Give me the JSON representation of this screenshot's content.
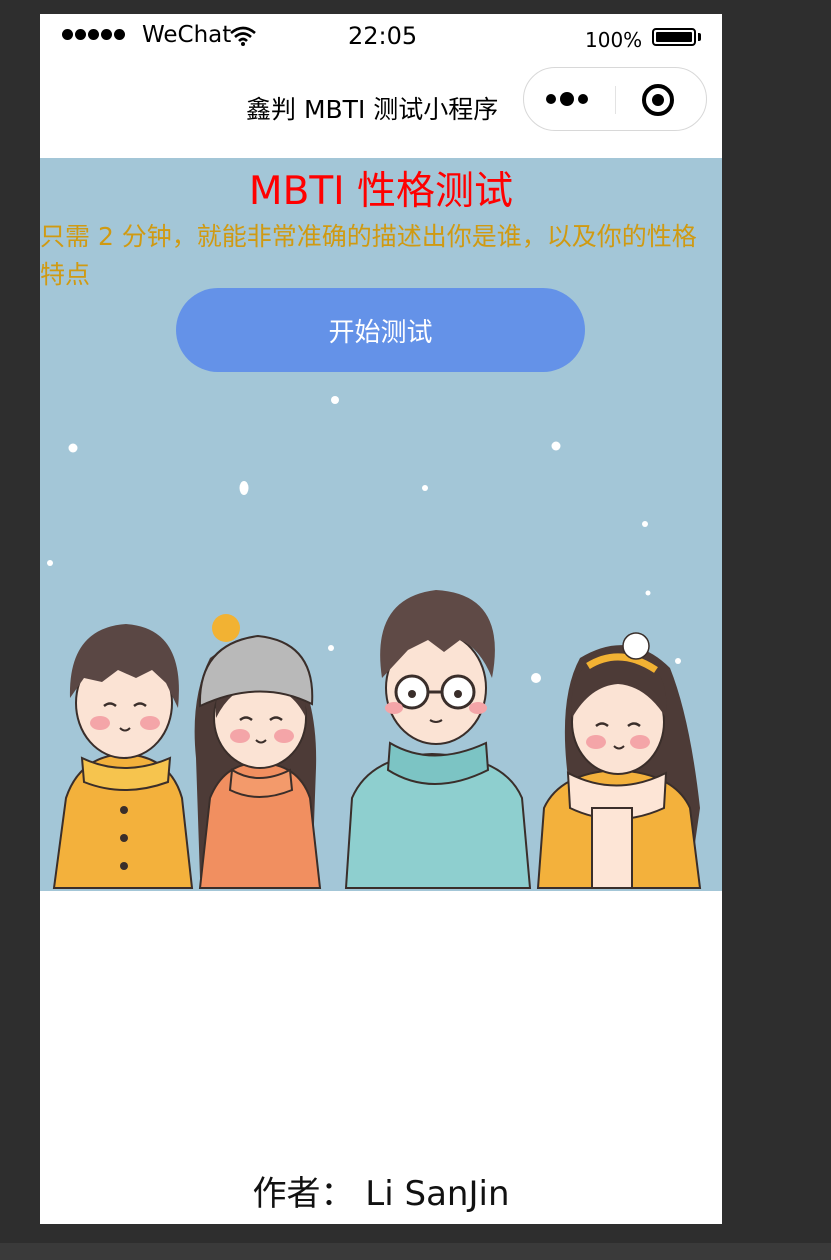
{
  "status_bar": {
    "carrier": "WeChat",
    "time": "22:05",
    "battery_percent": "100%"
  },
  "nav": {
    "title": "鑫判 MBTI 测试小程序"
  },
  "hero": {
    "title": "MBTI 性格测试",
    "description": "只需 2 分钟，就能非常准确的描述出你是谁，以及你的性格特点",
    "start_button": "开始测试"
  },
  "footer": {
    "author": "作者：  Li SanJin"
  },
  "colors": {
    "hero_bg": "#a3c6d7",
    "title": "#ff0000",
    "description": "#d09a12",
    "button": "#6492e8"
  }
}
